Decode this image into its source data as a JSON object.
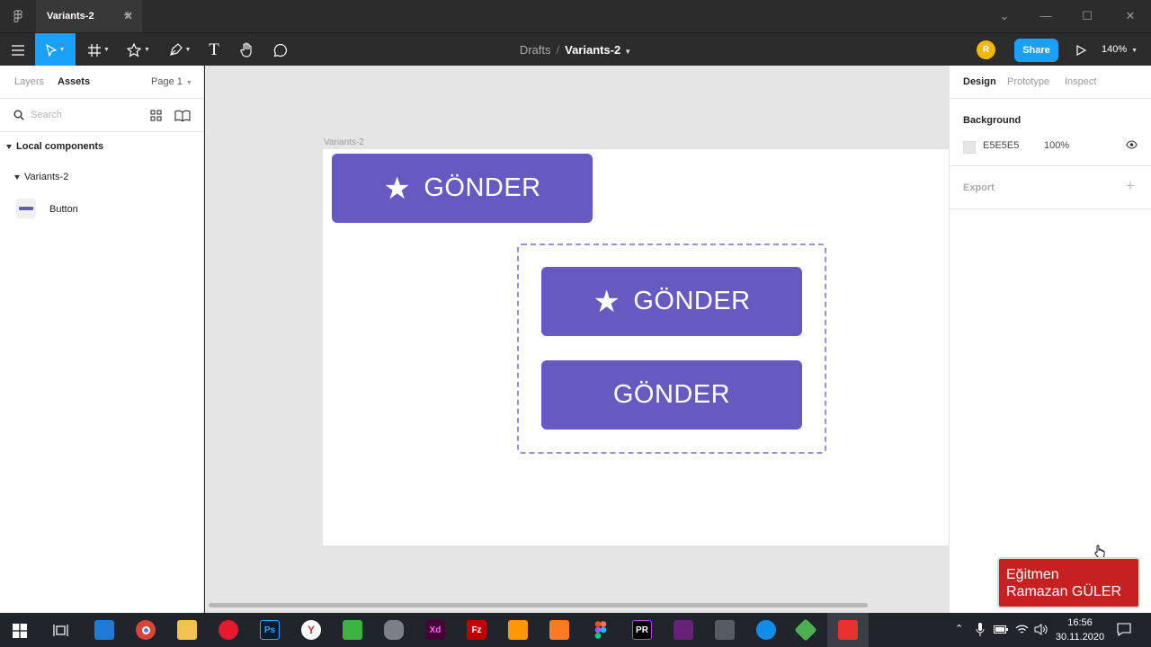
{
  "window": {
    "tab_title": "Variants-2",
    "tab_close": "✕",
    "new_tab": "+",
    "minimize": "—",
    "maximize": "☐",
    "close": "✕",
    "dropdown": "⌄"
  },
  "toolbar": {
    "tools": [
      "menu-icon",
      "move-tool-icon",
      "frame-tool-icon",
      "shape-tool-icon",
      "pen-tool-icon",
      "text-tool-icon",
      "hand-tool-icon",
      "comment-tool-icon"
    ],
    "text_tool_glyph": "T",
    "breadcrumb": {
      "folder": "Drafts",
      "separator": "/",
      "file": "Variants-2"
    },
    "avatar_initial": "R",
    "share_label": "Share",
    "zoom_label": "140%"
  },
  "left_panel": {
    "tabs": {
      "layers": "Layers",
      "assets": "Assets",
      "page": "Page 1"
    },
    "search_placeholder": "Search",
    "local_components_label": "Local components",
    "group_label": "Variants-2",
    "component_label": "Button"
  },
  "canvas": {
    "background": "#E5E5E5",
    "frame_label": "Variants-2",
    "buttons": [
      {
        "label": "GÖNDER",
        "icon": "star-icon",
        "icon_glyph": "★"
      },
      {
        "label": "GÖNDER",
        "icon": "star-icon",
        "icon_glyph": "★"
      },
      {
        "label": "GÖNDER"
      }
    ],
    "button_color": "#6559C2",
    "variant_border_color": "#9A8FDC"
  },
  "right_panel": {
    "tabs": {
      "design": "Design",
      "prototype": "Prototype",
      "inspect": "Inspect"
    },
    "background_title": "Background",
    "background_hex": "E5E5E5",
    "background_opacity": "100%",
    "export_title": "Export",
    "export_plus": "+"
  },
  "watermark": {
    "line1": "Eğitmen",
    "line2": "Ramazan GÜLER"
  },
  "taskbar": {
    "apps": [
      "windows-start-icon",
      "task-view-icon",
      "vscode-icon",
      "chrome-icon",
      "file-explorer-icon",
      "opera-icon",
      "photoshop-icon",
      "yandex-icon",
      "camtasia-icon",
      "recorder-icon",
      "adobe-xd-icon",
      "filezilla-icon",
      "sublime-text-icon",
      "xampp-icon",
      "figma-icon",
      "phpstorm-icon",
      "visual-studio-icon",
      "calculator-icon",
      "teamviewer-icon",
      "git-icon",
      "camtasia-active-icon"
    ],
    "photoshop_text": "Ps",
    "xd_text": "Xd",
    "filezilla_text": "Fz",
    "phpstorm_text": "PR",
    "time": "16:56",
    "date": "30.11.2020"
  }
}
